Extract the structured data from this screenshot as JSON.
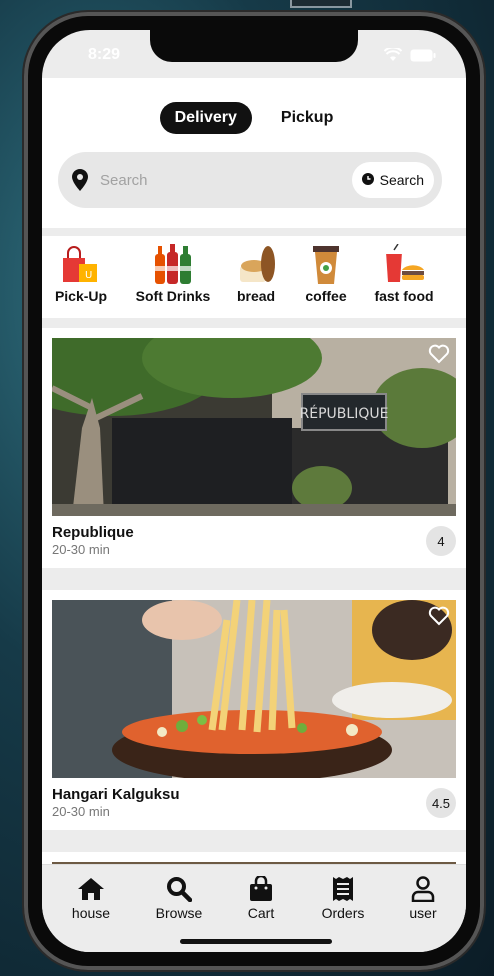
{
  "status": {
    "time": "8:29"
  },
  "mode_toggle": {
    "delivery_label": "Delivery",
    "pickup_label": "Pickup",
    "selected": "Delivery"
  },
  "search": {
    "placeholder": "Search",
    "button_label": "Search"
  },
  "categories": [
    {
      "label": "Pick-Up",
      "icon": "shopping-bags-icon"
    },
    {
      "label": "Soft Drinks",
      "icon": "soda-bottles-icon"
    },
    {
      "label": "bread",
      "icon": "bread-icon"
    },
    {
      "label": "coffee",
      "icon": "coffee-cup-icon"
    },
    {
      "label": "fast food",
      "icon": "burger-drink-icon"
    }
  ],
  "restaurants": [
    {
      "name": "Republique",
      "eta": "20-30 min",
      "rating": "4",
      "sign_text": "RÉPUBLIQUE"
    },
    {
      "name": "Hangari Kalguksu",
      "eta": "20-30 min",
      "rating": "4.5"
    }
  ],
  "tabbar": [
    {
      "label": "house",
      "icon": "house-icon"
    },
    {
      "label": "Browse",
      "icon": "search-icon"
    },
    {
      "label": "Cart",
      "icon": "shopping-bag-icon"
    },
    {
      "label": "Orders",
      "icon": "receipt-icon"
    },
    {
      "label": "user",
      "icon": "user-icon"
    }
  ],
  "colors": {
    "accent": "#111111",
    "screen_bg": "#ececec",
    "card_bg": "#ffffff",
    "muted_text": "#777777"
  }
}
